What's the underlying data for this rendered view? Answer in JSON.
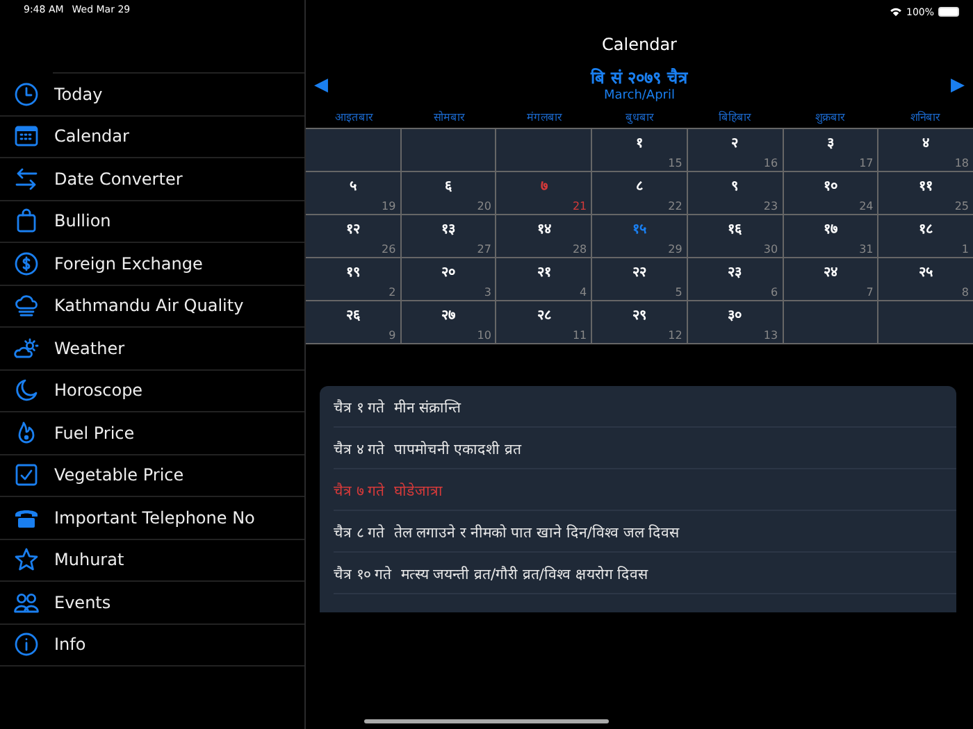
{
  "status_bar": {
    "time": "9:48 AM",
    "date": "Wed Mar 29",
    "battery": "100%"
  },
  "sidebar": {
    "items": [
      {
        "label": "Today"
      },
      {
        "label": "Calendar"
      },
      {
        "label": "Date Converter"
      },
      {
        "label": "Bullion"
      },
      {
        "label": "Foreign Exchange"
      },
      {
        "label": "Kathmandu Air Quality"
      },
      {
        "label": "Weather"
      },
      {
        "label": "Horoscope"
      },
      {
        "label": "Fuel Price"
      },
      {
        "label": "Vegetable Price"
      },
      {
        "label": "Important Telephone No"
      },
      {
        "label": "Muhurat"
      },
      {
        "label": "Events"
      },
      {
        "label": "Info"
      }
    ]
  },
  "header": {
    "title": "Calendar"
  },
  "month": {
    "title": "बि सं २०७९ चैत्र",
    "subtitle": "March/April",
    "prev": "◀",
    "next": "▶"
  },
  "weekdays": [
    "आइतबार",
    "सोमबार",
    "मंगलबार",
    "बुधबार",
    "बिहिबार",
    "शुक्रबार",
    "शनिबार"
  ],
  "days": [
    {
      "kind": "empty"
    },
    {
      "kind": "empty"
    },
    {
      "kind": "empty"
    },
    {
      "kind": "normal",
      "day": "१",
      "ad": "15"
    },
    {
      "kind": "normal",
      "day": "२",
      "ad": "16"
    },
    {
      "kind": "normal",
      "day": "३",
      "ad": "17"
    },
    {
      "kind": "normal",
      "day": "४",
      "ad": "18"
    },
    {
      "kind": "normal",
      "day": "५",
      "ad": "19"
    },
    {
      "kind": "normal",
      "day": "६",
      "ad": "20"
    },
    {
      "kind": "holiday",
      "day": "७",
      "ad": "21"
    },
    {
      "kind": "normal",
      "day": "८",
      "ad": "22"
    },
    {
      "kind": "normal",
      "day": "९",
      "ad": "23"
    },
    {
      "kind": "normal",
      "day": "१०",
      "ad": "24"
    },
    {
      "kind": "normal",
      "day": "११",
      "ad": "25"
    },
    {
      "kind": "normal",
      "day": "१२",
      "ad": "26"
    },
    {
      "kind": "normal",
      "day": "१३",
      "ad": "27"
    },
    {
      "kind": "normal",
      "day": "१४",
      "ad": "28"
    },
    {
      "kind": "today",
      "day": "१५",
      "ad": "29"
    },
    {
      "kind": "normal",
      "day": "१६",
      "ad": "30"
    },
    {
      "kind": "normal",
      "day": "१७",
      "ad": "31"
    },
    {
      "kind": "normal",
      "day": "१८",
      "ad": "1"
    },
    {
      "kind": "normal",
      "day": "१९",
      "ad": "2"
    },
    {
      "kind": "normal",
      "day": "२०",
      "ad": "3"
    },
    {
      "kind": "normal",
      "day": "२१",
      "ad": "4"
    },
    {
      "kind": "normal",
      "day": "२२",
      "ad": "5"
    },
    {
      "kind": "normal",
      "day": "२३",
      "ad": "6"
    },
    {
      "kind": "normal",
      "day": "२४",
      "ad": "7"
    },
    {
      "kind": "normal",
      "day": "२५",
      "ad": "8"
    },
    {
      "kind": "normal",
      "day": "२६",
      "ad": "9"
    },
    {
      "kind": "normal",
      "day": "२७",
      "ad": "10"
    },
    {
      "kind": "normal",
      "day": "२८",
      "ad": "11"
    },
    {
      "kind": "normal",
      "day": "२९",
      "ad": "12"
    },
    {
      "kind": "normal",
      "day": "३०",
      "ad": "13"
    },
    {
      "kind": "empty"
    },
    {
      "kind": "empty"
    }
  ],
  "events": [
    {
      "date": "चैत्र १ गते",
      "name": "मीन संक्रान्ति",
      "holiday": false
    },
    {
      "date": "चैत्र ४ गते",
      "name": "पापमोचनी एकादशी व्रत",
      "holiday": false
    },
    {
      "date": "चैत्र ७ गते",
      "name": "घोडेजात्रा",
      "holiday": true
    },
    {
      "date": "चैत्र ८ गते",
      "name": "तेल लगाउने र नीमको पात खाने दिन/विश्व जल दिवस",
      "holiday": false
    },
    {
      "date": "चैत्र १० गते",
      "name": "मत्स्य जयन्ती व्रत/गौरी व्रत/विश्व क्षयरोग दिवस",
      "holiday": false
    }
  ]
}
